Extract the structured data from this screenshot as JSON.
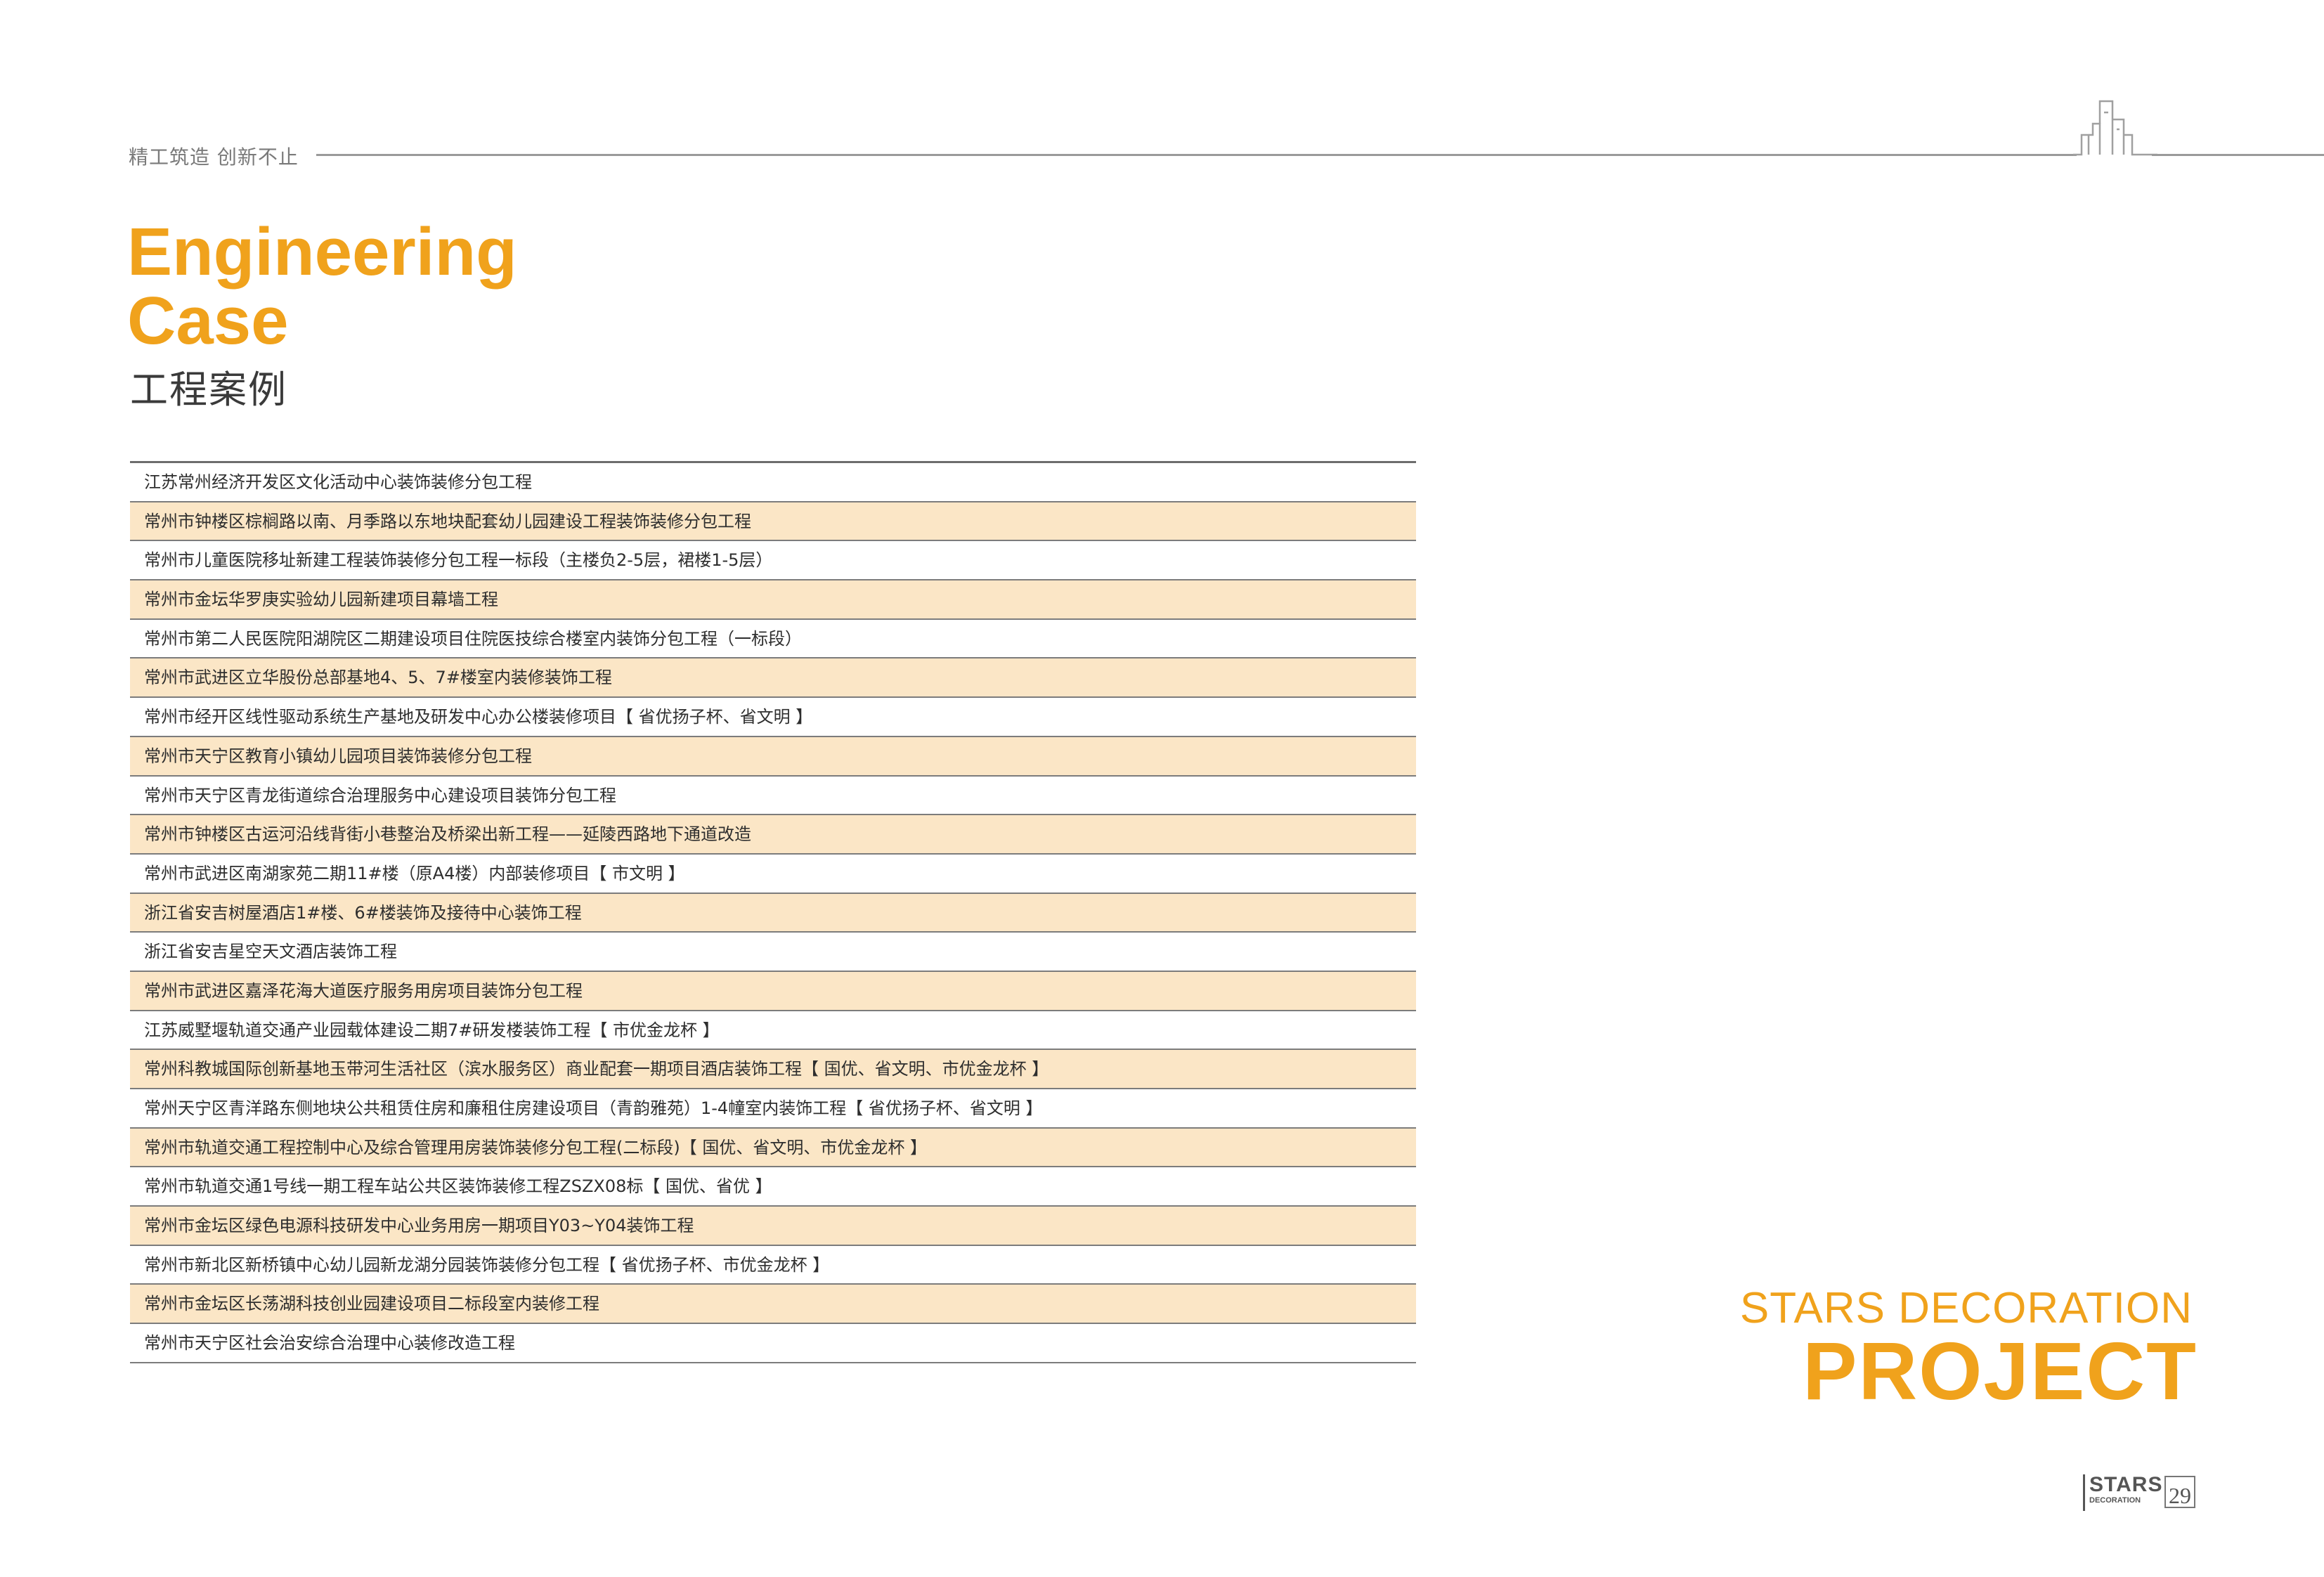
{
  "header": {
    "slogan": "精工筑造  创新不止"
  },
  "title": {
    "en_line1": "Engineering",
    "en_line2": "Case",
    "cn": "工程案例"
  },
  "projects": [
    "江苏常州经济开发区文化活动中心装饰装修分包工程",
    "常州市钟楼区棕榈路以南、月季路以东地块配套幼儿园建设工程装饰装修分包工程",
    "常州市儿童医院移址新建工程装饰装修分包工程一标段（主楼负2-5层，裙楼1-5层）",
    "常州市金坛华罗庚实验幼儿园新建项目幕墙工程",
    "常州市第二人民医院阳湖院区二期建设项目住院医技综合楼室内装饰分包工程（一标段）",
    "常州市武进区立华股份总部基地4、5、7#楼室内装修装饰工程",
    "常州市经开区线性驱动系统生产基地及研发中心办公楼装修项目【 省优扬子杯、省文明 】",
    "常州市天宁区教育小镇幼儿园项目装饰装修分包工程",
    "常州市天宁区青龙街道综合治理服务中心建设项目装饰分包工程",
    "常州市钟楼区古运河沿线背街小巷整治及桥梁出新工程——延陵西路地下通道改造",
    "常州市武进区南湖家苑二期11#楼（原A4楼）内部装修项目【 市文明 】",
    "浙江省安吉树屋酒店1#楼、6#楼装饰及接待中心装饰工程",
    "浙江省安吉星空天文酒店装饰工程",
    "常州市武进区嘉泽花海大道医疗服务用房项目装饰分包工程",
    "江苏威墅堰轨道交通产业园载体建设二期7#研发楼装饰工程【 市优金龙杯 】",
    "常州科教城国际创新基地玉带河生活社区（滨水服务区）商业配套一期项目酒店装饰工程【 国优、省文明、市优金龙杯 】",
    "常州天宁区青洋路东侧地块公共租赁住房和廉租住房建设项目（青韵雅苑）1-4幢室内装饰工程【 省优扬子杯、省文明 】",
    "常州市轨道交通工程控制中心及综合管理用房装饰装修分包工程(二标段)【 国优、省文明、市优金龙杯 】",
    "常州市轨道交通1号线一期工程车站公共区装饰装修工程ZSZX08标【 国优、省优 】",
    "常州市金坛区绿色电源科技研发中心业务用房一期项目Y03~Y04装饰工程",
    "常州市新北区新桥镇中心幼儿园新龙湖分园装饰装修分包工程【 省优扬子杯、市优金龙杯 】",
    "常州市金坛区长荡湖科技创业园建设项目二标段室内装修工程",
    "常州市天宁区社会治安综合治理中心装修改造工程"
  ],
  "brand": {
    "sub": "STARS DECORATION",
    "main": "PROJECT"
  },
  "footer": {
    "logo_line1": "STARS",
    "logo_line2": "DECORATION",
    "page_number": "29"
  },
  "colors": {
    "accent": "#f0a21c",
    "row_highlight": "#fbe6c6",
    "rule": "#7c7c7c"
  },
  "icons": {
    "skyline": "building-skyline-icon"
  }
}
